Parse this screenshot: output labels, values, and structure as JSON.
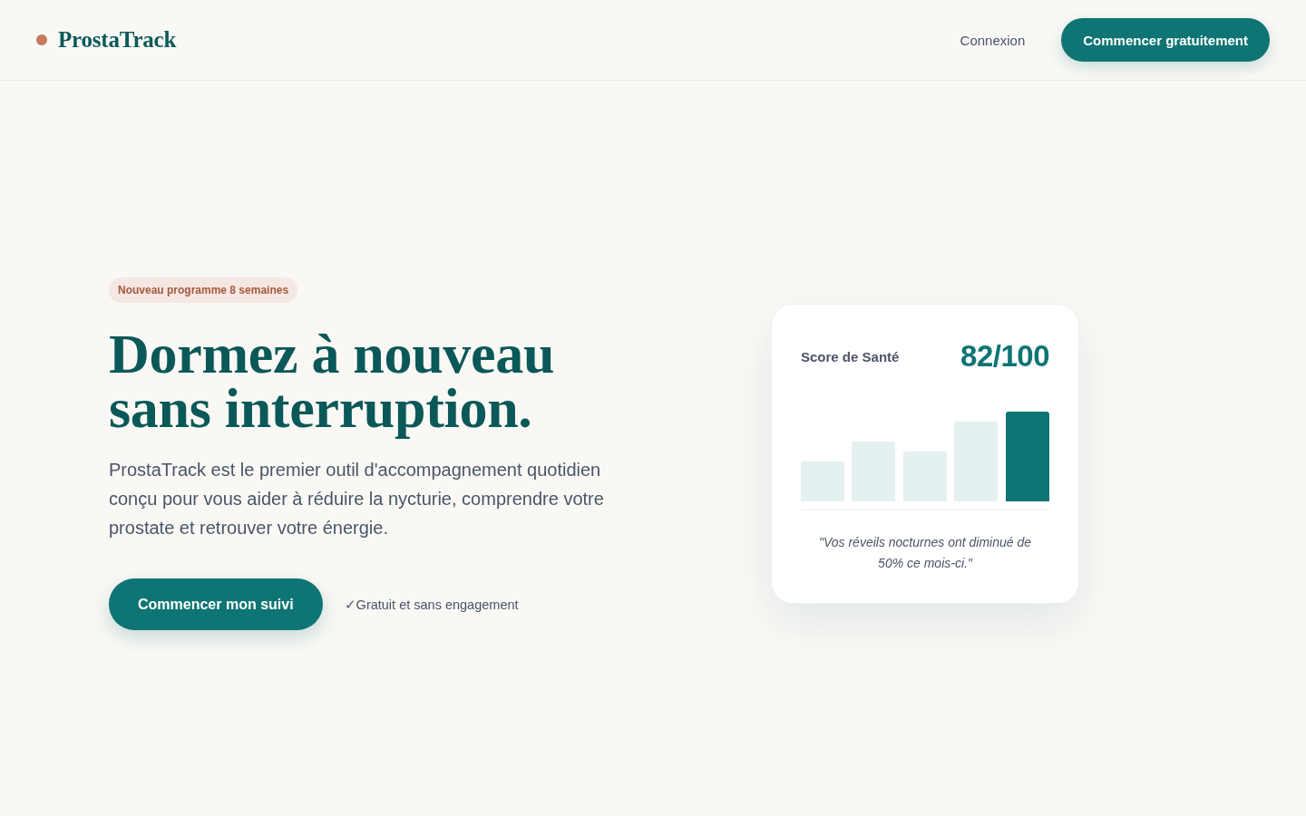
{
  "header": {
    "logo": "ProstaTrack",
    "links": [
      {
        "label": "Connexion"
      }
    ],
    "cta": "Commencer gratuitement"
  },
  "hero": {
    "badge": "Nouveau programme 8 semaines",
    "title": "Dormez à nouveau sans interruption.",
    "description": "ProstaTrack est le premier outil d'accompagnement quotidien conçu pour vous aider à réduire la nycturie, comprendre votre prostate et retrouver votre énergie.",
    "cta": "Commencer mon suivi",
    "note": "✓Gratuit et sans engagement"
  },
  "score_card": {
    "label": "Score de Santé",
    "score": "82/100",
    "quote": "\"Vos réveils nocturnes ont diminué de 50% ce mois-ci.\""
  }
}
